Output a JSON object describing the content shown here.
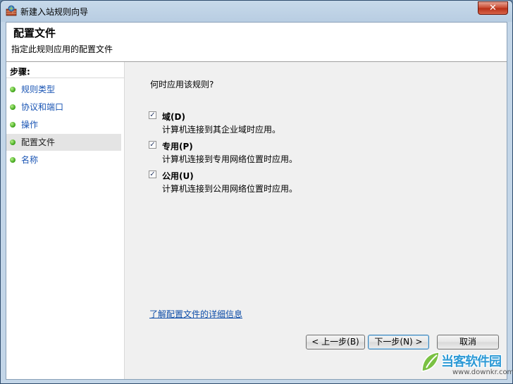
{
  "window": {
    "title": "新建入站规则向导",
    "close_glyph": "✕"
  },
  "header": {
    "title": "配置文件",
    "subtitle": "指定此规则应用的配置文件"
  },
  "sidebar": {
    "steps_label": "步骤:",
    "items": [
      {
        "label": "规则类型"
      },
      {
        "label": "协议和端口"
      },
      {
        "label": "操作"
      },
      {
        "label": "配置文件",
        "current": true
      },
      {
        "label": "名称"
      }
    ]
  },
  "main": {
    "question": "何时应用该规则?",
    "options": [
      {
        "label": "域(D)",
        "description": "计算机连接到其企业域时应用。",
        "checked": true
      },
      {
        "label": "专用(P)",
        "description": "计算机连接到专用网络位置时应用。",
        "checked": true
      },
      {
        "label": "公用(U)",
        "description": "计算机连接到公用网络位置时应用。",
        "checked": true
      }
    ],
    "learn_link": "了解配置文件的详细信息"
  },
  "buttons": {
    "back": "< 上一步(B)",
    "next": "下一步(N) >",
    "cancel": "取消"
  },
  "watermark": {
    "brand": "当客软件园",
    "url": "www.downkr.com"
  },
  "colors": {
    "link": "#0c4ca8",
    "step_dot": "#3fa61b",
    "brand": "#2e9ad6"
  }
}
